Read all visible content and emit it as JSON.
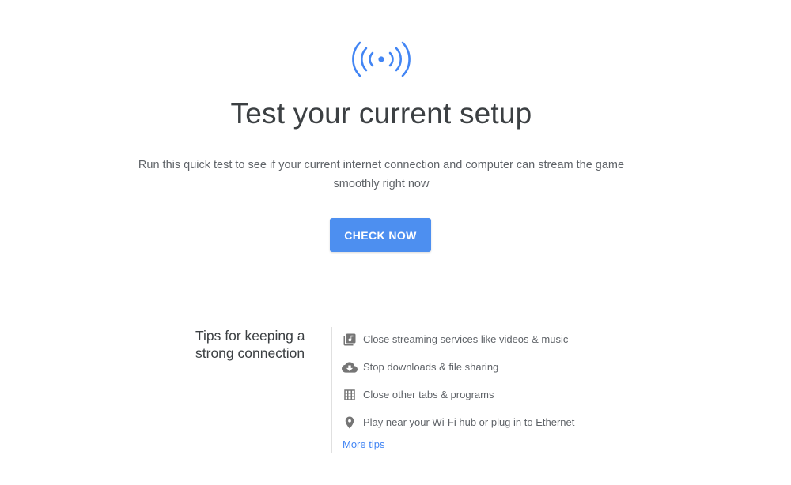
{
  "hero": {
    "icon": "broadcast-signal-icon",
    "title": "Test your current setup",
    "subtitle_line1": "Run this quick test to see if your current internet connection and computer can stream the game",
    "subtitle_line2": "smoothly right now",
    "button_label": "CHECK NOW"
  },
  "tips": {
    "heading": "Tips for keeping a strong connection",
    "items": [
      {
        "icon": "media-library-icon",
        "label": "Close streaming services like videos & music"
      },
      {
        "icon": "cloud-download-icon",
        "label": "Stop downloads & file sharing"
      },
      {
        "icon": "grid-apps-icon",
        "label": "Close other tabs & programs"
      },
      {
        "icon": "location-pin-icon",
        "label": "Play near your Wi-Fi hub or plug in to Ethernet"
      }
    ],
    "more_link": "More tips"
  },
  "colors": {
    "accent": "#4285f4",
    "button": "#4d8ff0",
    "icon_gray": "#757575",
    "text_dark": "#3c4043",
    "text_muted": "#5f6368"
  }
}
